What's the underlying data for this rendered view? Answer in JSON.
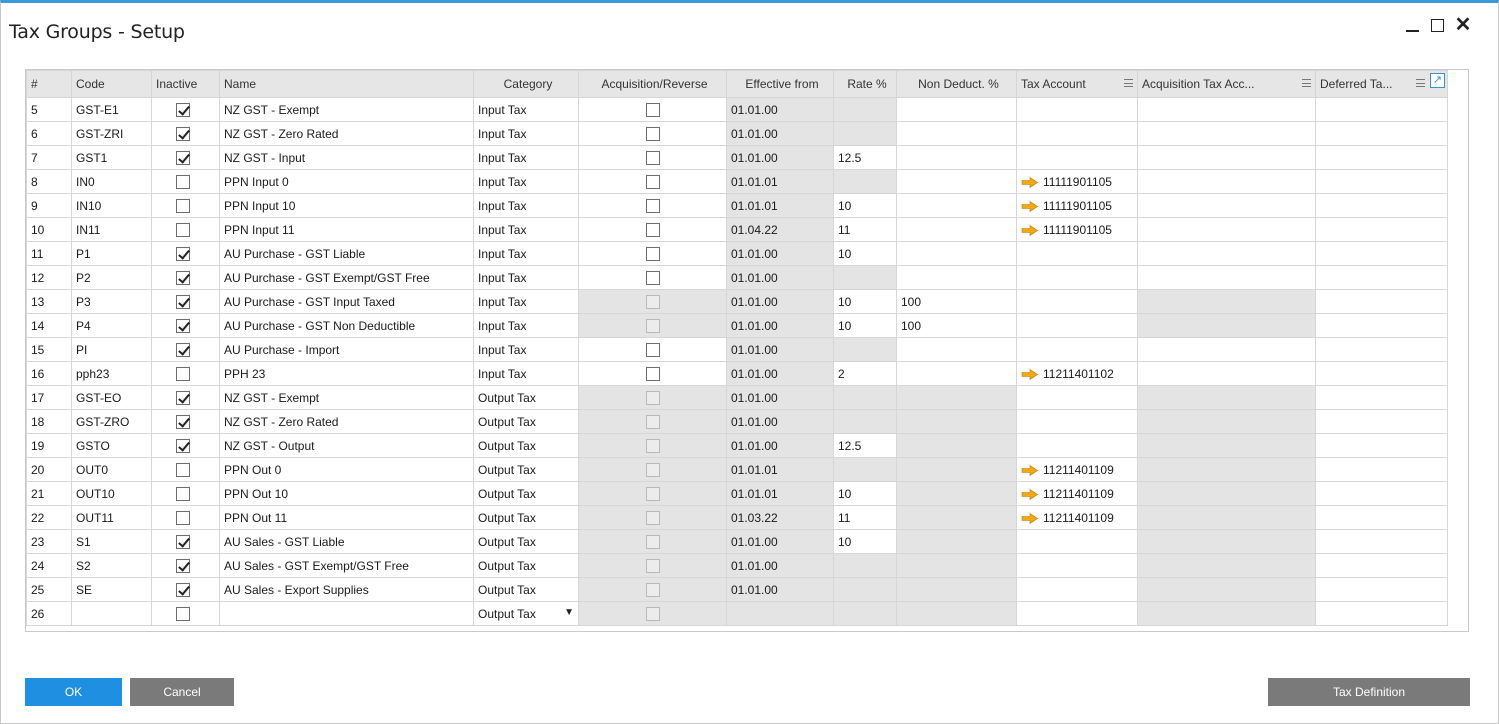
{
  "window": {
    "title": "Tax Groups - Setup"
  },
  "columns": [
    "#",
    "Code",
    "Inactive",
    "Name",
    "Category",
    "Acquisition/Reverse",
    "Effective from",
    "Rate %",
    "Non Deduct. %",
    "Tax Account",
    "Acquisition Tax Acc...",
    "Deferred Ta..."
  ],
  "rows": [
    {
      "num": "5",
      "code": "GST-E1",
      "inactive": true,
      "name": "NZ GST - Exempt",
      "category": "Input Tax",
      "acq_enabled": true,
      "eff": "01.01.00",
      "rate": "",
      "rate_gray": true,
      "nd": "",
      "nd_gray": false,
      "acct": "",
      "acq_gray": false
    },
    {
      "num": "6",
      "code": "GST-ZRI",
      "inactive": true,
      "name": "NZ GST - Zero Rated",
      "category": "Input Tax",
      "acq_enabled": true,
      "eff": "01.01.00",
      "rate": "",
      "rate_gray": true,
      "nd": "",
      "nd_gray": false,
      "acct": "",
      "acq_gray": false
    },
    {
      "num": "7",
      "code": "GST1",
      "inactive": true,
      "name": "NZ GST - Input",
      "category": "Input Tax",
      "acq_enabled": true,
      "eff": "01.01.00",
      "rate": "12.5",
      "rate_gray": false,
      "nd": "",
      "nd_gray": false,
      "acct": "",
      "acq_gray": false
    },
    {
      "num": "8",
      "code": "IN0",
      "inactive": false,
      "name": "PPN Input 0",
      "category": "Input Tax",
      "acq_enabled": true,
      "eff": "01.01.01",
      "rate": "",
      "rate_gray": true,
      "nd": "",
      "nd_gray": false,
      "acct": "11111901105",
      "acq_gray": false
    },
    {
      "num": "9",
      "code": "IN10",
      "inactive": false,
      "name": "PPN Input 10",
      "category": "Input Tax",
      "acq_enabled": true,
      "eff": "01.01.01",
      "rate": "10",
      "rate_gray": false,
      "nd": "",
      "nd_gray": false,
      "acct": "11111901105",
      "acq_gray": false
    },
    {
      "num": "10",
      "code": "IN11",
      "inactive": false,
      "name": "PPN Input 11",
      "category": "Input Tax",
      "acq_enabled": true,
      "eff": "01.04.22",
      "rate": "11",
      "rate_gray": false,
      "nd": "",
      "nd_gray": false,
      "acct": "11111901105",
      "acq_gray": false
    },
    {
      "num": "11",
      "code": "P1",
      "inactive": true,
      "name": "AU Purchase - GST Liable",
      "category": "Input Tax",
      "acq_enabled": true,
      "eff": "01.01.00",
      "rate": "10",
      "rate_gray": false,
      "nd": "",
      "nd_gray": false,
      "acct": "",
      "acq_gray": false
    },
    {
      "num": "12",
      "code": "P2",
      "inactive": true,
      "name": "AU Purchase - GST Exempt/GST Free",
      "category": "Input Tax",
      "acq_enabled": true,
      "eff": "01.01.00",
      "rate": "",
      "rate_gray": true,
      "nd": "",
      "nd_gray": false,
      "acct": "",
      "acq_gray": false
    },
    {
      "num": "13",
      "code": "P3",
      "inactive": true,
      "name": "AU Purchase - GST Input Taxed",
      "category": "Input Tax",
      "acq_enabled": false,
      "eff": "01.01.00",
      "rate": "10",
      "rate_gray": false,
      "nd": "100",
      "nd_gray": false,
      "acct": "",
      "acq_gray": true
    },
    {
      "num": "14",
      "code": "P4",
      "inactive": true,
      "name": "AU Purchase - GST Non Deductible",
      "category": "Input Tax",
      "acq_enabled": false,
      "eff": "01.01.00",
      "rate": "10",
      "rate_gray": false,
      "nd": "100",
      "nd_gray": false,
      "acct": "",
      "acq_gray": true
    },
    {
      "num": "15",
      "code": "PI",
      "inactive": true,
      "name": "AU Purchase - Import",
      "category": "Input Tax",
      "acq_enabled": true,
      "eff": "01.01.00",
      "rate": "",
      "rate_gray": true,
      "nd": "",
      "nd_gray": false,
      "acct": "",
      "acq_gray": false
    },
    {
      "num": "16",
      "code": "pph23",
      "inactive": false,
      "name": "PPH 23",
      "category": "Input Tax",
      "acq_enabled": true,
      "eff": "01.01.00",
      "rate": "2",
      "rate_gray": false,
      "nd": "",
      "nd_gray": false,
      "acct": "11211401102",
      "acq_gray": false
    },
    {
      "num": "17",
      "code": "GST-EO",
      "inactive": true,
      "name": "NZ GST - Exempt",
      "category": "Output Tax",
      "acq_enabled": false,
      "eff": "01.01.00",
      "rate": "",
      "rate_gray": true,
      "nd": "",
      "nd_gray": true,
      "acct": "",
      "acq_gray": true
    },
    {
      "num": "18",
      "code": "GST-ZRO",
      "inactive": true,
      "name": "NZ GST - Zero Rated",
      "category": "Output Tax",
      "acq_enabled": false,
      "eff": "01.01.00",
      "rate": "",
      "rate_gray": true,
      "nd": "",
      "nd_gray": true,
      "acct": "",
      "acq_gray": true
    },
    {
      "num": "19",
      "code": "GSTO",
      "inactive": true,
      "name": "NZ GST - Output",
      "category": "Output Tax",
      "acq_enabled": false,
      "eff": "01.01.00",
      "rate": "12.5",
      "rate_gray": false,
      "nd": "",
      "nd_gray": true,
      "acct": "",
      "acq_gray": true
    },
    {
      "num": "20",
      "code": "OUT0",
      "inactive": false,
      "name": "PPN Out 0",
      "category": "Output Tax",
      "acq_enabled": false,
      "eff": "01.01.01",
      "rate": "",
      "rate_gray": true,
      "nd": "",
      "nd_gray": true,
      "acct": "11211401109",
      "acq_gray": true
    },
    {
      "num": "21",
      "code": "OUT10",
      "inactive": false,
      "name": "PPN Out 10",
      "category": "Output Tax",
      "acq_enabled": false,
      "eff": "01.01.01",
      "rate": "10",
      "rate_gray": false,
      "nd": "",
      "nd_gray": true,
      "acct": "11211401109",
      "acq_gray": true
    },
    {
      "num": "22",
      "code": "OUT11",
      "inactive": false,
      "name": "PPN Out 11",
      "category": "Output Tax",
      "acq_enabled": false,
      "eff": "01.03.22",
      "rate": "11",
      "rate_gray": false,
      "nd": "",
      "nd_gray": true,
      "acct": "11211401109",
      "acq_gray": true
    },
    {
      "num": "23",
      "code": "S1",
      "inactive": true,
      "name": "AU Sales - GST Liable",
      "category": "Output Tax",
      "acq_enabled": false,
      "eff": "01.01.00",
      "rate": "10",
      "rate_gray": false,
      "nd": "",
      "nd_gray": true,
      "acct": "",
      "acq_gray": true
    },
    {
      "num": "24",
      "code": "S2",
      "inactive": true,
      "name": "AU Sales - GST Exempt/GST Free",
      "category": "Output Tax",
      "acq_enabled": false,
      "eff": "01.01.00",
      "rate": "",
      "rate_gray": true,
      "nd": "",
      "nd_gray": true,
      "acct": "",
      "acq_gray": true
    },
    {
      "num": "25",
      "code": "SE",
      "inactive": true,
      "name": "AU Sales - Export Supplies",
      "category": "Output Tax",
      "acq_enabled": false,
      "eff": "01.01.00",
      "rate": "",
      "rate_gray": true,
      "nd": "",
      "nd_gray": true,
      "acct": "",
      "acq_gray": true
    },
    {
      "num": "26",
      "code": "",
      "inactive": false,
      "name": "",
      "category": "Output Tax",
      "acq_enabled": false,
      "eff": "",
      "rate": "",
      "rate_gray": true,
      "nd": "",
      "nd_gray": true,
      "acct": "",
      "acq_gray": true,
      "dropdown": true
    }
  ],
  "buttons": {
    "ok": "OK",
    "cancel": "Cancel",
    "tax_definition": "Tax Definition"
  },
  "colors": {
    "accent": "#1e8fe1",
    "arrow": "#f0a818",
    "gray_cell": "#e4e4e4",
    "button_gray": "#7a7a7a"
  }
}
